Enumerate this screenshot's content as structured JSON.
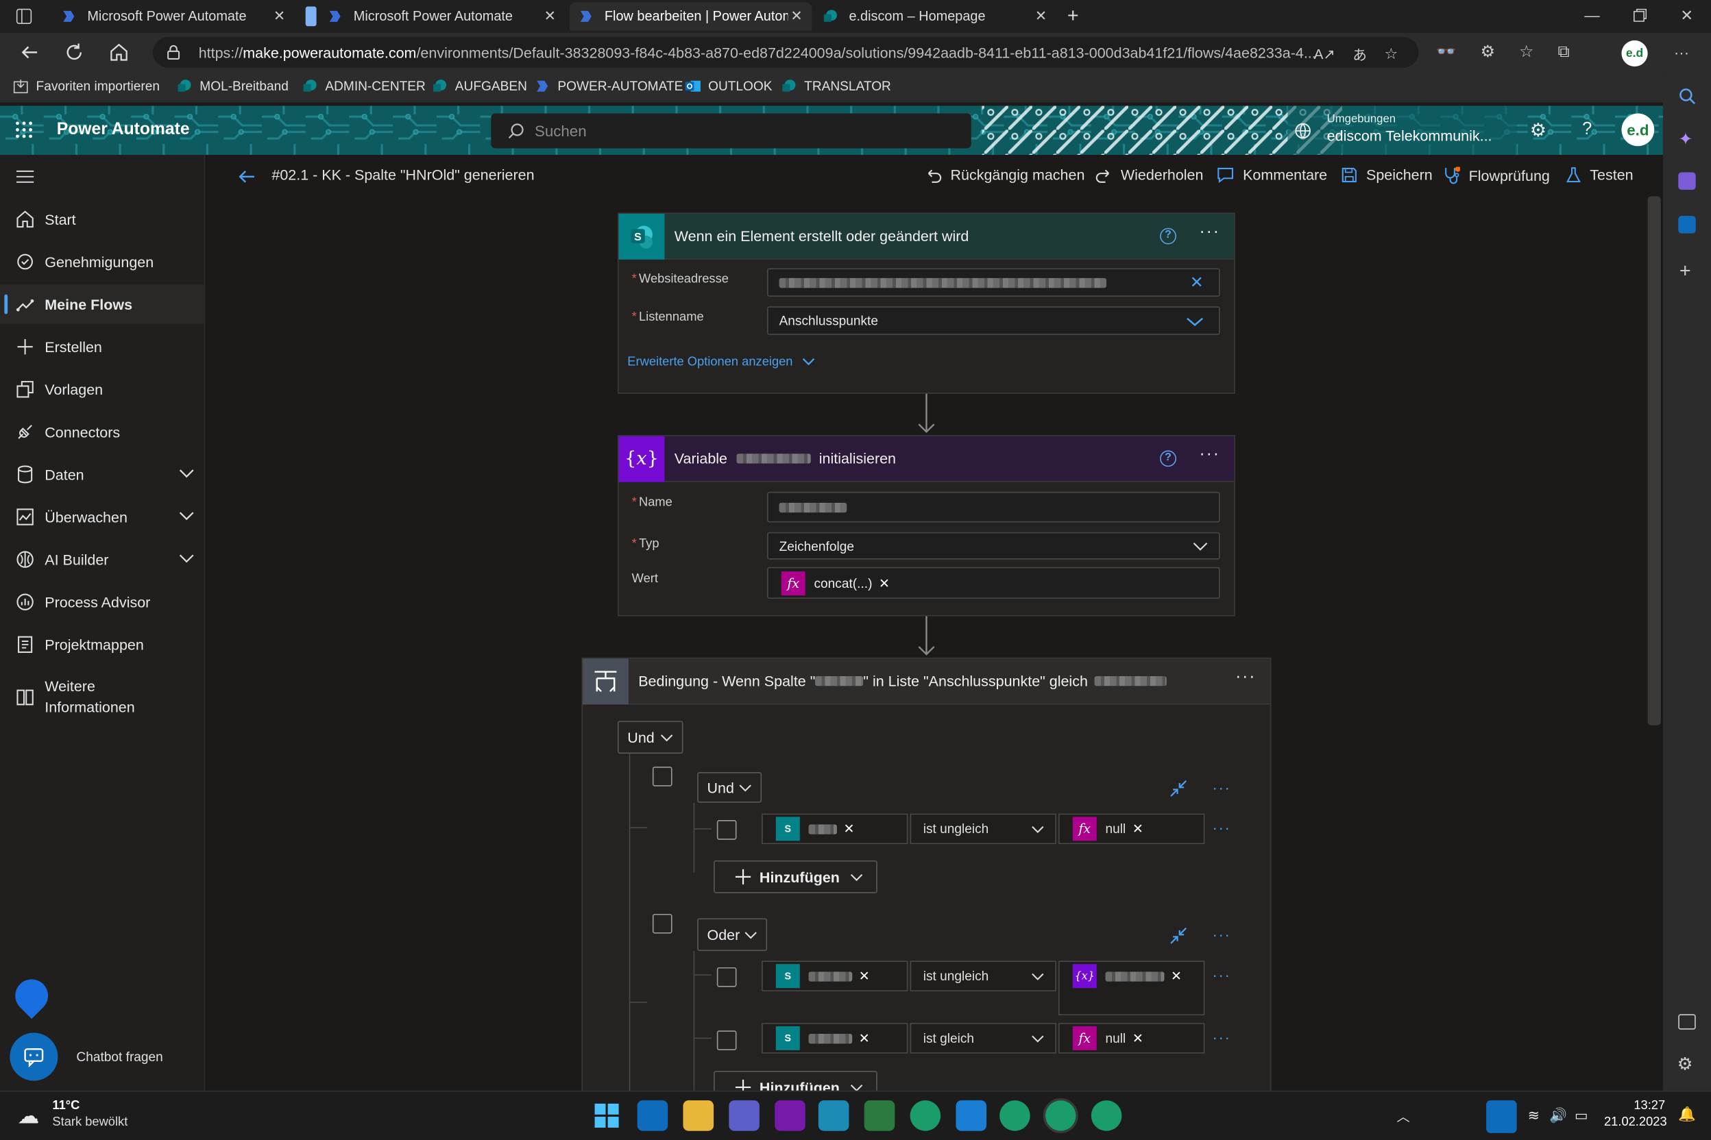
{
  "browser": {
    "tabs": [
      {
        "title": "Microsoft Power Automate",
        "close": "✕"
      },
      {
        "title": "Microsoft Power Automate",
        "close": "✕"
      },
      {
        "title": "Flow bearbeiten | Power Automa",
        "close": "✕"
      },
      {
        "title": "e.discom – Homepage",
        "close": "✕"
      }
    ],
    "new_tab": "+",
    "url_prefix": "https://",
    "url_host": "make.powerautomate.com",
    "url_path": "/environments/Default-38328093-f84c-4b83-a870-ed87d224009a/solutions/9942aadb-8411-eb11-a813-000d3ab41f21/flows/4ae8233a-4...",
    "favorites": [
      "Favoriten importieren",
      "MOL-Breitband",
      "ADMIN-CENTER",
      "AUFGABEN",
      "POWER-AUTOMATE",
      "OUTLOOK",
      "TRANSLATOR"
    ]
  },
  "header": {
    "app_name": "Power Automate",
    "search_placeholder": "Suchen",
    "env_label": "Umgebungen",
    "env_name": "ediscom Telekommunik...",
    "avatar": "e.d"
  },
  "sidebar": {
    "items": [
      {
        "label": "Start",
        "icon": "home-icon"
      },
      {
        "label": "Genehmigungen",
        "icon": "approvals-icon"
      },
      {
        "label": "Meine Flows",
        "icon": "flows-icon"
      },
      {
        "label": "Erstellen",
        "icon": "plus-icon"
      },
      {
        "label": "Vorlagen",
        "icon": "templates-icon"
      },
      {
        "label": "Connectors",
        "icon": "connectors-icon"
      },
      {
        "label": "Daten",
        "icon": "data-icon"
      },
      {
        "label": "Überwachen",
        "icon": "monitor-icon"
      },
      {
        "label": "AI Builder",
        "icon": "ai-builder-icon"
      },
      {
        "label": "Process Advisor",
        "icon": "process-advisor-icon"
      },
      {
        "label": "Projektmappen",
        "icon": "solutions-icon"
      },
      {
        "label": "Weitere",
        "label2": "Informationen",
        "icon": "learn-icon"
      }
    ],
    "chatbot": "Chatbot fragen"
  },
  "commandbar": {
    "flow_title": "#02.1 - KK - Spalte \"HNrOld\" generieren",
    "undo": "Rückgängig machen",
    "redo": "Wiederholen",
    "comments": "Kommentare",
    "save": "Speichern",
    "checker": "Flowprüfung",
    "test": "Testen"
  },
  "trigger": {
    "title": "Wenn ein Element erstellt oder geändert wird",
    "site_label": "Websiteadresse",
    "list_label": "Listenname",
    "list_value": "Anschlusspunkte",
    "advanced": "Erweiterte Optionen anzeigen"
  },
  "variable": {
    "title_pre": "Variable",
    "title_post": "initialisieren",
    "name_label": "Name",
    "type_label": "Typ",
    "type_value": "Zeichenfolge",
    "value_label": "Wert",
    "value_token": "concat(...)"
  },
  "condition": {
    "title_pre": "Bedingung - Wenn Spalte \"",
    "title_mid": "\" in Liste \"Anschlusspunkte\" gleich",
    "root_op": "Und",
    "group1_op": "Und",
    "group2_op": "Oder",
    "op_not_equal": "ist ungleich",
    "op_equal": "ist gleich",
    "null_token": "null",
    "add": "Hinzufügen"
  },
  "taskbar": {
    "temp": "11°C",
    "weather": "Stark bewölkt",
    "time": "13:27",
    "date": "21.02.2023"
  },
  "colors": {
    "accent": "#4aa0f0",
    "sharepoint": "#038387",
    "variable": "#770bd6",
    "expression": "#ad008c",
    "condition": "#484f58"
  }
}
